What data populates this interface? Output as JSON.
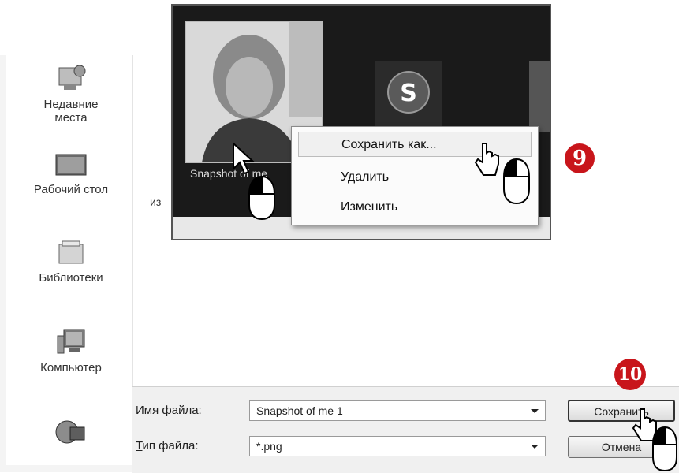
{
  "sidebar": {
    "items": [
      {
        "label": "Недавние\nместа",
        "icon": "recent-places-icon"
      },
      {
        "label": "Рабочий стол",
        "icon": "desktop-icon"
      },
      {
        "label": "Библиотеки",
        "icon": "libraries-icon"
      },
      {
        "label": "Компьютер",
        "icon": "computer-icon"
      },
      {
        "label": "",
        "icon": "network-icon"
      }
    ]
  },
  "content": {
    "partial_label": "из"
  },
  "bottom": {
    "filename_label_u": "И",
    "filename_label_rest": "мя файла:",
    "filename_value": "Snapshot of me 1",
    "filetype_label_u": "Т",
    "filetype_label_rest": "ип файла:",
    "filetype_value": "*.png",
    "save_button": "Сохранить",
    "cancel_button": "Отмена"
  },
  "overlay": {
    "thumbnail_label": "Snapshot of me",
    "context_menu": {
      "items": [
        "Сохранить как...",
        "Удалить",
        "Изменить"
      ]
    }
  },
  "badges": {
    "step_9": "9",
    "step_10": "10"
  },
  "colors": {
    "badge": "#c8151b",
    "overlay_bg": "#1a1a1a",
    "menu_bg": "#fbfbfb"
  }
}
